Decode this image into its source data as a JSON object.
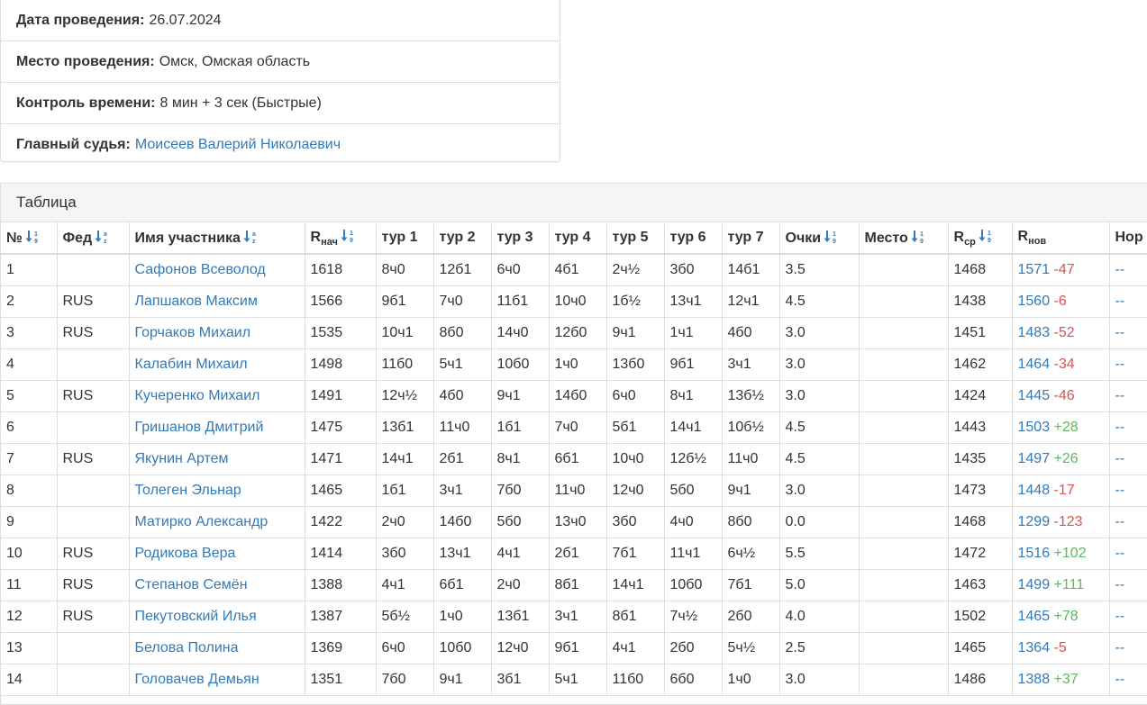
{
  "info": {
    "date_label": "Дата проведения:",
    "date_value": "26.07.2024",
    "place_label": "Место проведения:",
    "place_value": "Омск, Омская область",
    "time_label": "Контроль времени:",
    "time_value": "8 мин + 3 сек (Быстрые)",
    "judge_label": "Главный судья:",
    "judge_value": "Моисеев Валерий Николаевич"
  },
  "table_heading": "Таблица",
  "columns": {
    "num": "№",
    "fed": "Фед",
    "name": "Имя участника",
    "rstart_main": "R",
    "rstart_sub": "нач",
    "r1": "тур 1",
    "r2": "тур 2",
    "r3": "тур 3",
    "r4": "тур 4",
    "r5": "тур 5",
    "r6": "тур 6",
    "r7": "тур 7",
    "points": "Очки",
    "place": "Место",
    "ravg_main": "R",
    "ravg_sub": "ср",
    "rnew_main": "R",
    "rnew_sub": "нов",
    "norm": "Нор"
  },
  "colors": {
    "link": "#337ab7",
    "negative": "#d9534f",
    "positive": "#5cb85c"
  },
  "rows": [
    {
      "num": "1",
      "fed": "",
      "name": "Сафонов Всеволод",
      "rstart": "1618",
      "rounds": [
        "8ч0",
        "12б1",
        "6ч0",
        "4б1",
        "2ч½",
        "3б0",
        "14б1"
      ],
      "points": "3.5",
      "place": "",
      "ravg": "1468",
      "rnew": "1571",
      "delta": "-47",
      "norm": "--"
    },
    {
      "num": "2",
      "fed": "RUS",
      "name": "Лапшаков Максим",
      "rstart": "1566",
      "rounds": [
        "9б1",
        "7ч0",
        "11б1",
        "10ч0",
        "1б½",
        "13ч1",
        "12ч1"
      ],
      "points": "4.5",
      "place": "",
      "ravg": "1438",
      "rnew": "1560",
      "delta": "-6",
      "norm": "--"
    },
    {
      "num": "3",
      "fed": "RUS",
      "name": "Горчаков Михаил",
      "rstart": "1535",
      "rounds": [
        "10ч1",
        "8б0",
        "14ч0",
        "12б0",
        "9ч1",
        "1ч1",
        "4б0"
      ],
      "points": "3.0",
      "place": "",
      "ravg": "1451",
      "rnew": "1483",
      "delta": "-52",
      "norm": "--"
    },
    {
      "num": "4",
      "fed": "",
      "name": "Калабин Михаил",
      "rstart": "1498",
      "rounds": [
        "11б0",
        "5ч1",
        "10б0",
        "1ч0",
        "13б0",
        "9б1",
        "3ч1"
      ],
      "points": "3.0",
      "place": "",
      "ravg": "1462",
      "rnew": "1464",
      "delta": "-34",
      "norm": "--"
    },
    {
      "num": "5",
      "fed": "RUS",
      "name": "Кучеренко Михаил",
      "rstart": "1491",
      "rounds": [
        "12ч½",
        "4б0",
        "9ч1",
        "14б0",
        "6ч0",
        "8ч1",
        "13б½"
      ],
      "points": "3.0",
      "place": "",
      "ravg": "1424",
      "rnew": "1445",
      "delta": "-46",
      "norm": "--"
    },
    {
      "num": "6",
      "fed": "",
      "name": "Гришанов Дмитрий",
      "rstart": "1475",
      "rounds": [
        "13б1",
        "11ч0",
        "1б1",
        "7ч0",
        "5б1",
        "14ч1",
        "10б½"
      ],
      "points": "4.5",
      "place": "",
      "ravg": "1443",
      "rnew": "1503",
      "delta": "+28",
      "norm": "--"
    },
    {
      "num": "7",
      "fed": "RUS",
      "name": "Якунин Артем",
      "rstart": "1471",
      "rounds": [
        "14ч1",
        "2б1",
        "8ч1",
        "6б1",
        "10ч0",
        "12б½",
        "11ч0"
      ],
      "points": "4.5",
      "place": "",
      "ravg": "1435",
      "rnew": "1497",
      "delta": "+26",
      "norm": "--"
    },
    {
      "num": "8",
      "fed": "",
      "name": "Толеген Эльнар",
      "rstart": "1465",
      "rounds": [
        "1б1",
        "3ч1",
        "7б0",
        "11ч0",
        "12ч0",
        "5б0",
        "9ч1"
      ],
      "points": "3.0",
      "place": "",
      "ravg": "1473",
      "rnew": "1448",
      "delta": "-17",
      "norm": "--"
    },
    {
      "num": "9",
      "fed": "",
      "name": "Матирко Александр",
      "rstart": "1422",
      "rounds": [
        "2ч0",
        "14б0",
        "5б0",
        "13ч0",
        "3б0",
        "4ч0",
        "8б0"
      ],
      "points": "0.0",
      "place": "",
      "ravg": "1468",
      "rnew": "1299",
      "delta": "-123",
      "norm": "--"
    },
    {
      "num": "10",
      "fed": "RUS",
      "name": "Родикова Вера",
      "rstart": "1414",
      "rounds": [
        "3б0",
        "13ч1",
        "4ч1",
        "2б1",
        "7б1",
        "11ч1",
        "6ч½"
      ],
      "points": "5.5",
      "place": "",
      "ravg": "1472",
      "rnew": "1516",
      "delta": "+102",
      "norm": "--"
    },
    {
      "num": "11",
      "fed": "RUS",
      "name": "Степанов Семён",
      "rstart": "1388",
      "rounds": [
        "4ч1",
        "6б1",
        "2ч0",
        "8б1",
        "14ч1",
        "10б0",
        "7б1"
      ],
      "points": "5.0",
      "place": "",
      "ravg": "1463",
      "rnew": "1499",
      "delta": "+111",
      "norm": "--"
    },
    {
      "num": "12",
      "fed": "RUS",
      "name": "Пекутовский Илья",
      "rstart": "1387",
      "rounds": [
        "5б½",
        "1ч0",
        "13б1",
        "3ч1",
        "8б1",
        "7ч½",
        "2б0"
      ],
      "points": "4.0",
      "place": "",
      "ravg": "1502",
      "rnew": "1465",
      "delta": "+78",
      "norm": "--"
    },
    {
      "num": "13",
      "fed": "",
      "name": "Белова Полина",
      "rstart": "1369",
      "rounds": [
        "6ч0",
        "10б0",
        "12ч0",
        "9б1",
        "4ч1",
        "2б0",
        "5ч½"
      ],
      "points": "2.5",
      "place": "",
      "ravg": "1465",
      "rnew": "1364",
      "delta": "-5",
      "norm": "--"
    },
    {
      "num": "14",
      "fed": "",
      "name": "Головачев Демьян",
      "rstart": "1351",
      "rounds": [
        "7б0",
        "9ч1",
        "3б1",
        "5ч1",
        "11б0",
        "6б0",
        "1ч0"
      ],
      "points": "3.0",
      "place": "",
      "ravg": "1486",
      "rnew": "1388",
      "delta": "+37",
      "norm": "--"
    }
  ]
}
